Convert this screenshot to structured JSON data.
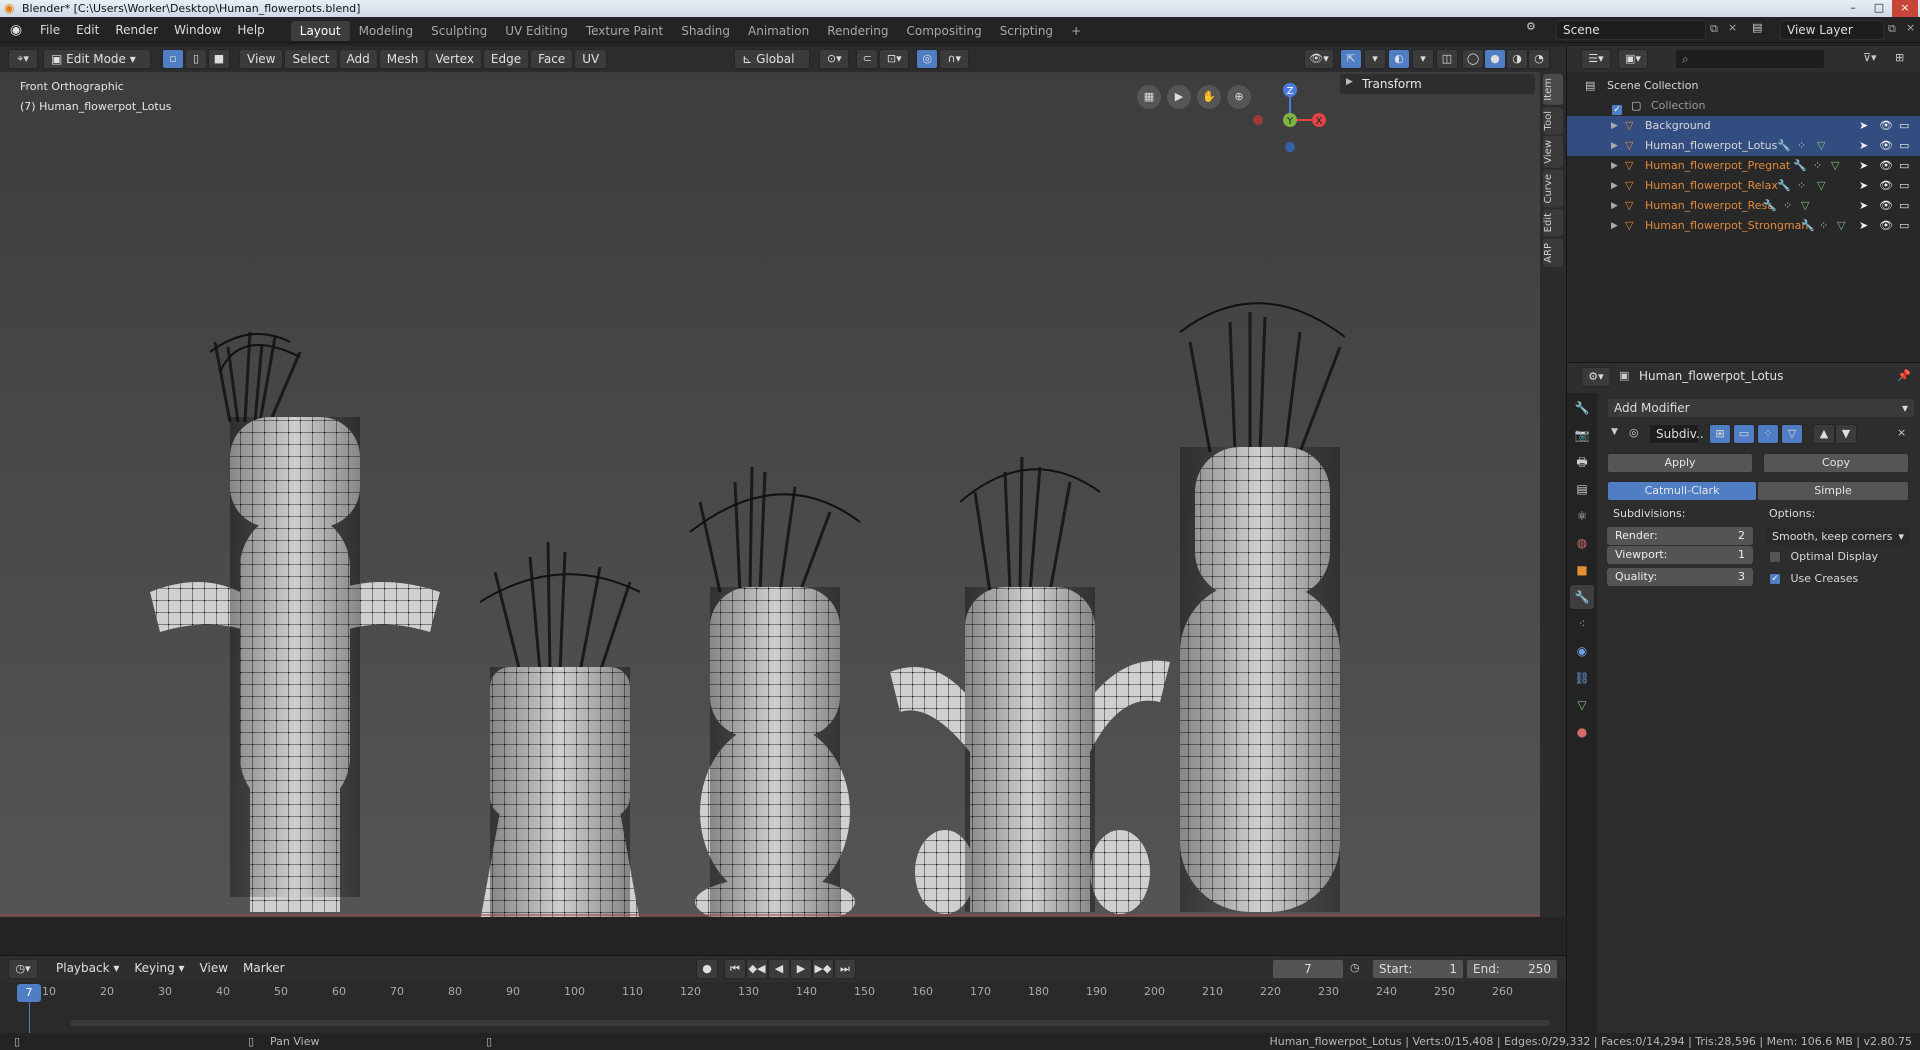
{
  "window": {
    "title": "Blender* [C:\\Users\\Worker\\Desktop\\Human_flowerpots.blend]",
    "controls": [
      "–",
      "□",
      "×"
    ]
  },
  "menu": [
    "File",
    "Edit",
    "Render",
    "Window",
    "Help"
  ],
  "workspaces": [
    "Layout",
    "Modeling",
    "Sculpting",
    "UV Editing",
    "Texture Paint",
    "Shading",
    "Animation",
    "Rendering",
    "Compositing",
    "Scripting",
    "+"
  ],
  "active_workspace": "Layout",
  "scene": {
    "label": "Scene",
    "view_layer": "View Layer"
  },
  "viewport_header": {
    "mode": "Edit Mode",
    "menus": [
      "View",
      "Select",
      "Add",
      "Mesh",
      "Vertex",
      "Edge",
      "Face",
      "UV"
    ],
    "orientation": "Global"
  },
  "viewport": {
    "view_name": "Front Orthographic",
    "object_label": "(7) Human_flowerpot_Lotus",
    "gizmo": {
      "x": "X",
      "y": "Y",
      "z": "Z"
    },
    "transform_panel": "Transform",
    "side_tabs": [
      "Item",
      "Tool",
      "View",
      "Curve",
      "Edit",
      "ARP"
    ]
  },
  "outliner": {
    "root": "Scene Collection",
    "collection": "Collection",
    "objects": [
      {
        "name": "Background",
        "selected": true,
        "color": "white"
      },
      {
        "name": "Human_flowerpot_Lotus",
        "selected": true,
        "color": "white"
      },
      {
        "name": "Human_flowerpot_Pregnat",
        "selected": false,
        "color": "orange"
      },
      {
        "name": "Human_flowerpot_Relax",
        "selected": false,
        "color": "orange"
      },
      {
        "name": "Human_flowerpot_Rest",
        "selected": false,
        "color": "orange"
      },
      {
        "name": "Human_flowerpot_Strongman",
        "selected": false,
        "color": "orange"
      }
    ]
  },
  "properties": {
    "object_name": "Human_flowerpot_Lotus",
    "add_modifier": "Add Modifier",
    "modifier_name": "Subdiv..",
    "apply": "Apply",
    "copy": "Copy",
    "catmull": "Catmull-Clark",
    "simple": "Simple",
    "subdivisions_label": "Subdivisions:",
    "render_label": "Render:",
    "render_value": "2",
    "viewport_label": "Viewport:",
    "viewport_value": "1",
    "quality_label": "Quality:",
    "quality_value": "3",
    "options_label": "Options:",
    "uv_smooth": "Smooth, keep corners",
    "optimal_display": "Optimal Display",
    "use_creases": "Use Creases"
  },
  "timeline": {
    "menus": [
      "Playback",
      "Keying",
      "View",
      "Marker"
    ],
    "current_frame": "7",
    "start_label": "Start:",
    "start": "1",
    "end_label": "End:",
    "end": "250",
    "ruler": [
      "10",
      "20",
      "30",
      "40",
      "50",
      "60",
      "70",
      "80",
      "90",
      "100",
      "110",
      "120",
      "130",
      "140",
      "150",
      "160",
      "170",
      "180",
      "190",
      "200",
      "210",
      "220",
      "230",
      "240",
      "250",
      "260"
    ],
    "playhead": "7"
  },
  "status": {
    "hint": "Pan View",
    "stats": "Human_flowerpot_Lotus | Verts:0/15,408 | Edges:0/29,332 | Faces:0/14,294 | Tris:28,596 | Mem: 106.6 MB | v2.80.75"
  }
}
